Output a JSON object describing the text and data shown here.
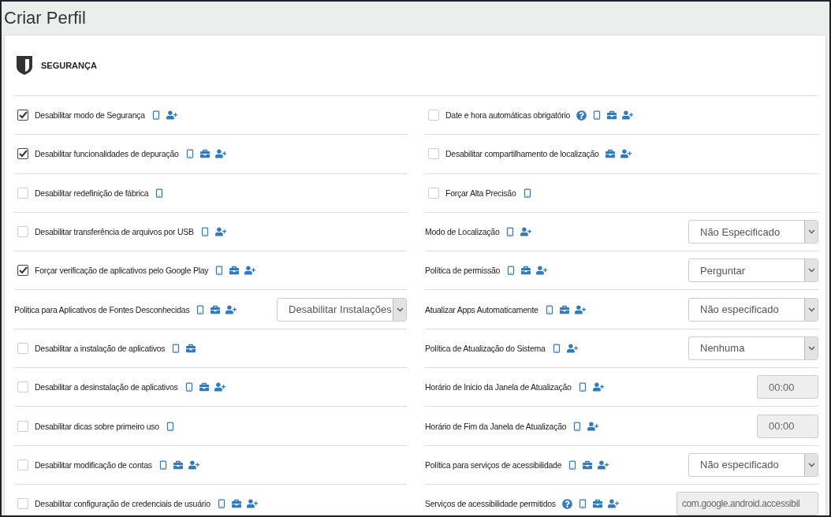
{
  "window": {
    "title": "Criar Perfil"
  },
  "section": {
    "title": "SEGURANÇA"
  },
  "columns": [
    {
      "rows": [
        {
          "kind": "checkbox",
          "label": "Desabilitar modo de Segurança",
          "checked": true,
          "icons": {
            "help": false,
            "device": true,
            "work": false,
            "user": true
          }
        },
        {
          "kind": "checkbox",
          "label": "Desabilitar funcionalidades de depuração",
          "checked": true,
          "icons": {
            "help": false,
            "device": true,
            "work": true,
            "user": true
          }
        },
        {
          "kind": "checkbox",
          "label": "Desabilitar redefinição de fábrica",
          "checked": false,
          "icons": {
            "help": false,
            "device": true,
            "work": false,
            "user": false
          }
        },
        {
          "kind": "checkbox",
          "label": "Desabilitar transferência de arquivos por USB",
          "checked": false,
          "icons": {
            "help": false,
            "device": true,
            "work": false,
            "user": true
          }
        },
        {
          "kind": "checkbox",
          "label": "Forçar verificação de aplicativos pelo Google Play",
          "checked": true,
          "icons": {
            "help": false,
            "device": true,
            "work": true,
            "user": true
          }
        },
        {
          "kind": "select",
          "label": "Politica para Aplicativos de Fontes Desconhecidas",
          "value": "Desabilitar Instalações",
          "icons": {
            "help": false,
            "device": true,
            "work": true,
            "user": true
          }
        },
        {
          "kind": "checkbox",
          "label": "Desabilitar a instalação de aplicativos",
          "checked": false,
          "icons": {
            "help": false,
            "device": true,
            "work": true,
            "user": false
          }
        },
        {
          "kind": "checkbox",
          "label": "Desabilitar a desinstalação de aplicativos",
          "checked": false,
          "icons": {
            "help": false,
            "device": true,
            "work": true,
            "user": true
          }
        },
        {
          "kind": "checkbox",
          "label": "Desabilitar dicas sobre primeiro uso",
          "checked": false,
          "icons": {
            "help": false,
            "device": true,
            "work": false,
            "user": false
          }
        },
        {
          "kind": "checkbox",
          "label": "Desabilitar modificação de contas",
          "checked": false,
          "icons": {
            "help": false,
            "device": true,
            "work": true,
            "user": true
          }
        },
        {
          "kind": "checkbox",
          "label": "Desabilitar configuração de credenciais de usuário",
          "checked": false,
          "icons": {
            "help": false,
            "device": true,
            "work": true,
            "user": true
          }
        }
      ]
    },
    {
      "rows": [
        {
          "kind": "checkbox",
          "label": "Date e hora automáticas obrigatório",
          "checked": false,
          "icons": {
            "help": true,
            "device": true,
            "work": true,
            "user": true
          }
        },
        {
          "kind": "checkbox",
          "label": "Desabilitar compartilhamento de localização",
          "checked": false,
          "icons": {
            "help": false,
            "device": false,
            "work": true,
            "user": true
          }
        },
        {
          "kind": "checkbox",
          "label": "Forçar Alta Precisão",
          "checked": false,
          "icons": {
            "help": false,
            "device": true,
            "work": false,
            "user": false
          }
        },
        {
          "kind": "select",
          "label": "Modo de Localização",
          "value": "Não Especificado",
          "icons": {
            "help": false,
            "device": true,
            "work": false,
            "user": true
          }
        },
        {
          "kind": "select",
          "label": "Política de permissão",
          "value": "Perguntar",
          "icons": {
            "help": false,
            "device": true,
            "work": true,
            "user": true
          }
        },
        {
          "kind": "select",
          "label": "Atualizar Apps Automaticamente",
          "value": "Não especificado",
          "icons": {
            "help": false,
            "device": true,
            "work": true,
            "user": true
          }
        },
        {
          "kind": "select",
          "label": "Política de Atualização do Sistema",
          "value": "Nenhuma",
          "icons": {
            "help": false,
            "device": true,
            "work": false,
            "user": true
          }
        },
        {
          "kind": "time",
          "label": "Horário de Inicio da Janela de Atualização",
          "value": "00:00",
          "disabled": true,
          "icons": {
            "help": false,
            "device": true,
            "work": false,
            "user": true
          }
        },
        {
          "kind": "time",
          "label": "Horário de Fim da Janela de Atualização",
          "value": "00:00",
          "disabled": true,
          "icons": {
            "help": false,
            "device": true,
            "work": false,
            "user": true
          }
        },
        {
          "kind": "select",
          "label": "Política para serviços de acessibilidade",
          "value": "Não especificado",
          "icons": {
            "help": false,
            "device": true,
            "work": true,
            "user": true
          }
        },
        {
          "kind": "text",
          "label": "Serviços de acessibilidade permitidos",
          "value": "com.google.android.accessibil",
          "disabled": true,
          "icons": {
            "help": true,
            "device": true,
            "work": true,
            "user": true
          }
        }
      ]
    }
  ]
}
